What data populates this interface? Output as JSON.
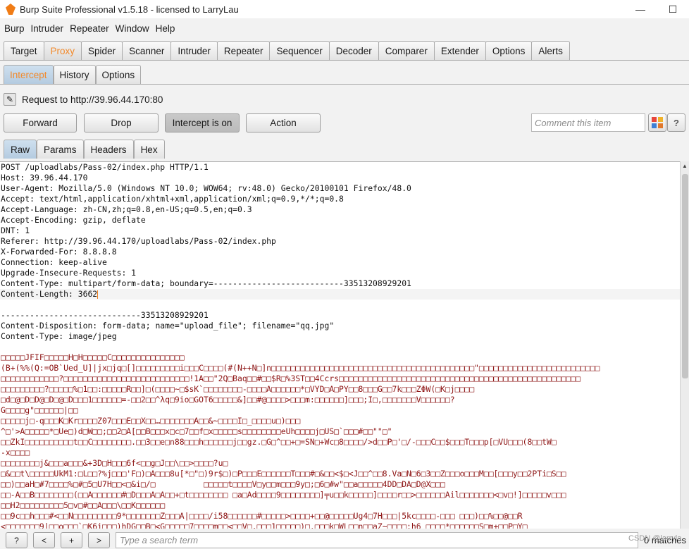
{
  "window": {
    "title": "Burp Suite Professional v1.5.18 - licensed to LarryLau",
    "minimize_glyph": "—",
    "maximize_glyph": "☐"
  },
  "menu": [
    "Burp",
    "Intruder",
    "Repeater",
    "Window",
    "Help"
  ],
  "main_tabs": [
    "Target",
    "Proxy",
    "Spider",
    "Scanner",
    "Intruder",
    "Repeater",
    "Sequencer",
    "Decoder",
    "Comparer",
    "Extender",
    "Options",
    "Alerts"
  ],
  "main_tab_active": "Proxy",
  "proxy_tabs": [
    "Intercept",
    "History",
    "Options"
  ],
  "proxy_tab_active": "Intercept",
  "request_label": "Request to http://39.96.44.170:80",
  "buttons": {
    "forward": "Forward",
    "drop": "Drop",
    "intercept": "Intercept is on",
    "action": "Action"
  },
  "comment_placeholder": "Comment this item",
  "help_glyph": "?",
  "view_tabs": [
    "Raw",
    "Params",
    "Headers",
    "Hex"
  ],
  "view_tab_active": "Raw",
  "request_lines": [
    "POST /uploadlabs/Pass-02/index.php HTTP/1.1",
    "Host: 39.96.44.170",
    "User-Agent: Mozilla/5.0 (Windows NT 10.0; WOW64; rv:48.0) Gecko/20100101 Firefox/48.0",
    "Accept: text/html,application/xhtml+xml,application/xml;q=0.9,*/*;q=0.8",
    "Accept-Language: zh-CN,zh;q=0.8,en-US;q=0.5,en;q=0.3",
    "Accept-Encoding: gzip, deflate",
    "DNT: 1",
    "Referer: http://39.96.44.170/uploadlabs/Pass-02/index.php",
    "X-Forwarded-For: 8.8.8.8",
    "Connection: keep-alive",
    "Upgrade-Insecure-Requests: 1",
    "Content-Type: multipart/form-data; boundary=---------------------------33513208929201",
    "Content-Length: 3662",
    "",
    "-----------------------------33513208929201",
    "Content-Disposition: form-data; name=\"upload_file\"; filename=\"qq.jpg\"",
    "Content-Type: image/jpeg",
    ""
  ],
  "binary_lines": [
    "□□□□□JFIF□□□□□H□H□□□□□C□□□□□□□□□□□□□□□",
    "(B+(%%(Q:=OB`Ued_U]|jx□jq□[]□□□□□□□□□i□□□C□□□□(#(N++N□]n□□□□□□□□□□□□□□□□□□□□□□□□□□□□□□□□□□□□□□□□□□\"□□□□□□□□□□□□□□□□□□□□□□□□□",
    "□□□□□□□□□□□□?□□□□□□□□□□□□□□□□□□□□□□□□□□!1A□□\"2Q□Baq□□#□□$R□%3ST□□4Ccrs□□□□□□□□□□□□□□□□□□□□□□□□□□□□□□□□□□□□□□□□□□□□□□□□□□",
    "□□□□□□□□□?□□□□□%□1□□:□□□□□R□□]□(□□□□~□$sK`□□□□□□□□-□□□□A□□□□□□*□VYD□A□PY□□8□□□G□□7k□□□ZΦW(□K□j□□□□",
    "□d□@□D□D@□D□@□D□□□1□□□□□□=-□□2□□^λq□9io□GOT6□□□□□&]□□#@□□□□>□□□m:□□□□□□]□□□;I□,□□□□□□□V□□□□□□?",
    "G□□□□g\"□□□□□□|□□",
    "□□□□□j□-q□□□K□Kr□□□□Z07□□□E□□X□□…□□□□□□□A□□&~□□□□I□_□□□□u□)□□□",
    "^□'>A□□□□□*□Ue□)d□W□□;□□2□A[□□B□□□x□c□7□□f□x□□□□□s□□□□□□□□eUh□□□□j□US□`□□□#□□\"\"□\"",
    "□□ZkI□□□□□□□□□□t□□C□□□□□□□□.□□3□□e□n88□□□h□□□□□□j□□gz.□G□^□□+□=SN□+Wc□8□□□□/>d□□P□'□/-□□□C□□$□□□T□□□p[□VU□□□(8□□tW□",
    "-x□□□□",
    "□□□□□□□□j&□□□a□□□&+3D□H□□□6f<□□g□J□□\\□□>□□□□?u□",
    "□&□□t\\□□□□□UkM1:□L□□?%j□□□'F□)□A□□□8u[*□\"□)9r$□)□P□□□E□□□□□□T□□□#□&□□<$□<J□□^□□8.Va□N□6□3□□Z□□□o□□□M□□[□□□y□□2PTi□S□□",
    "□□)□□aH□#7□□□□%□#□5□U7H□□<□&i□/□          □□□□□t□□□□V□y□□m□□□9y□;□6□#w\"□□a□□□□□4DD□DA□D@X□□□",
    "□□-A□□B□□□□□□□□(□□A□□□□□□#□D□□□A□A□□+□t□□□□□□□□ □a□Ad□□□□9□□□□□□□□]╤u□□k□□□□□]□□□□r□□>□□□□□□Ail□□□□□□□<□v□!]□□□□□v□□□",
    "□□H2□□□□□□□□□5□v□#□□A□□□\\□□K□□□□□□",
    "□□9c□□h□□□#<□□N□□□□□□□□□9*□□□□□□□Z□□□A|□□□□/i58□□□□□□#□□□□□>□□□□+□□@□□□□□Ug4□7H□□□|5kc□□□□-□□□ □□□)□□%□□@□□R",
    "<□□□□□□□9|□□o□□□`□K6i□□□)hDG□□B□<G□□□□□7□□□□m□□<□□V□,□□□1□□□□□)□.□□□k□WL□□n□□aZ~□□□□;h6 □□□□*□□□□□□S□m+□□P□Y□"
  ],
  "search": {
    "placeholder": "Type a search term",
    "matches": "0 matches",
    "prev": "<",
    "next": ">",
    "add": "+",
    "help": "?"
  },
  "watermark": "CSDN @larryla"
}
